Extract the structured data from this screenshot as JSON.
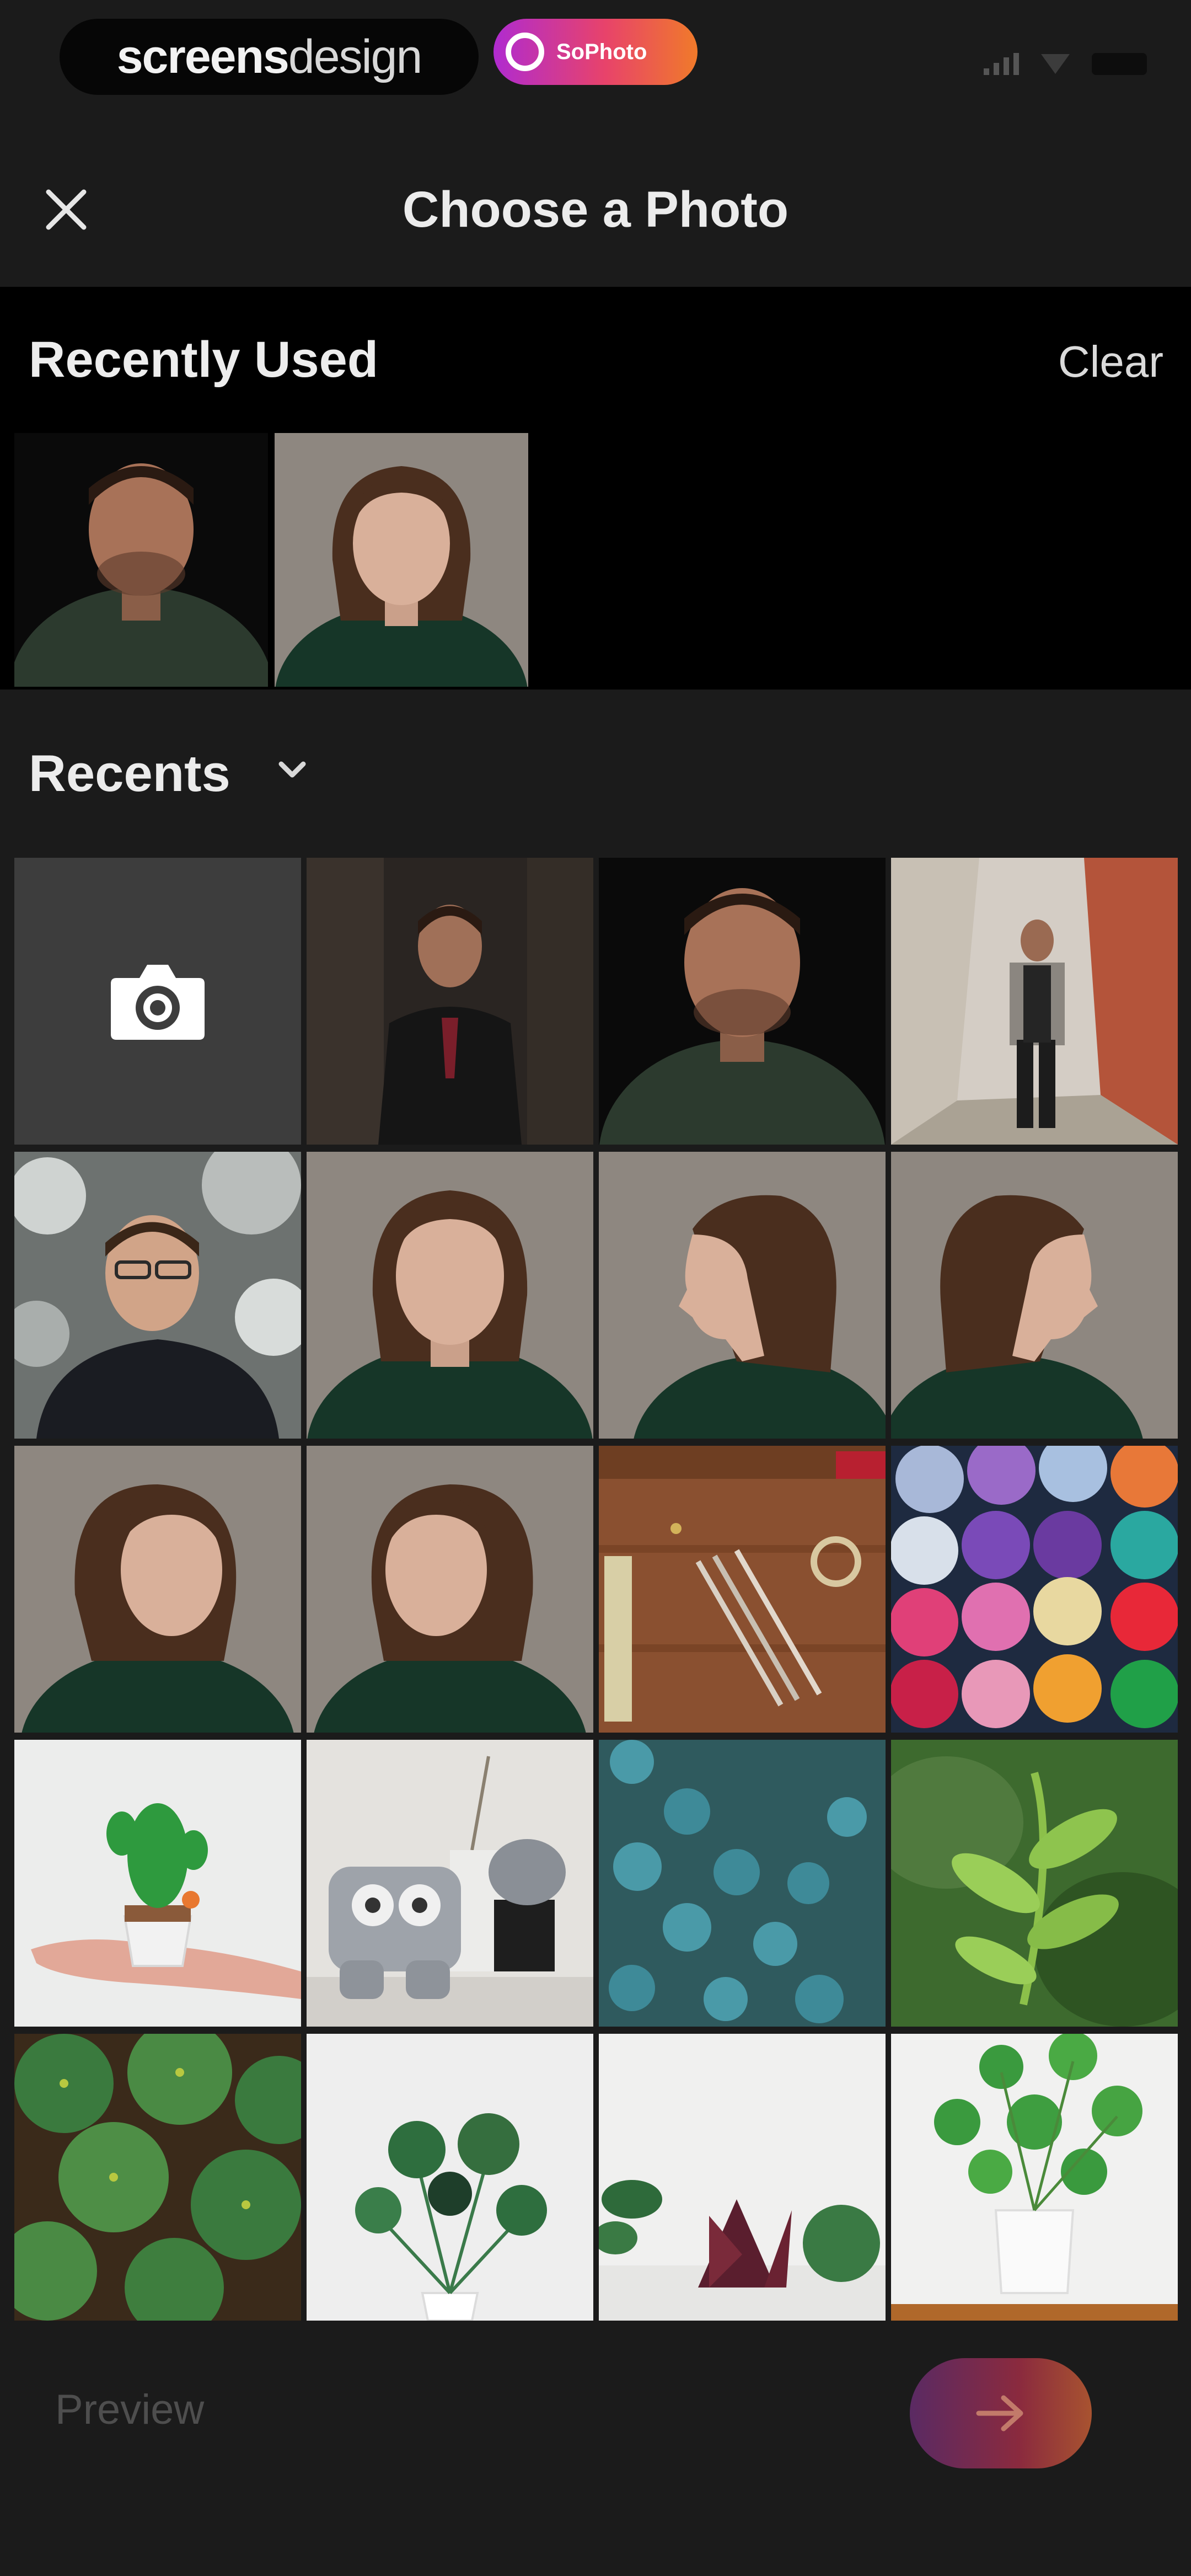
{
  "status_bar": {
    "brand_bold": "screens",
    "brand_regular": "design",
    "app_badge": "SoPhoto"
  },
  "header": {
    "title": "Choose a Photo",
    "close_icon": "close-icon"
  },
  "recently_used": {
    "title": "Recently Used",
    "clear_label": "Clear",
    "thumbs": [
      "man-dark-portrait",
      "woman-portrait-front"
    ]
  },
  "album": {
    "title": "Recents",
    "chevron_icon": "chevron-down-icon"
  },
  "grid": {
    "camera_icon": "camera-icon",
    "photos": [
      "man-in-suit-dark",
      "man-dark-portrait",
      "man-standing-alley",
      "man-glasses-snow",
      "woman-portrait-front",
      "woman-profile-left",
      "woman-profile-right",
      "woman-three-quarter-left",
      "woman-three-quarter-right",
      "craft-tools-wood",
      "colorful-yarn-balls",
      "cactus-on-hand",
      "robot-toy",
      "teal-flowers",
      "green-plant-leaves",
      "pilea-leaves-closeup",
      "pilea-white-pot",
      "plants-shelf",
      "plant-white-pot"
    ]
  },
  "bottom_bar": {
    "preview_label": "Preview",
    "next_icon": "arrow-right-icon"
  },
  "colors": {
    "background": "#1b1b1b",
    "section_black": "#000000",
    "accent_gradient_start": "#5a2a63",
    "accent_gradient_end": "#a85330"
  }
}
